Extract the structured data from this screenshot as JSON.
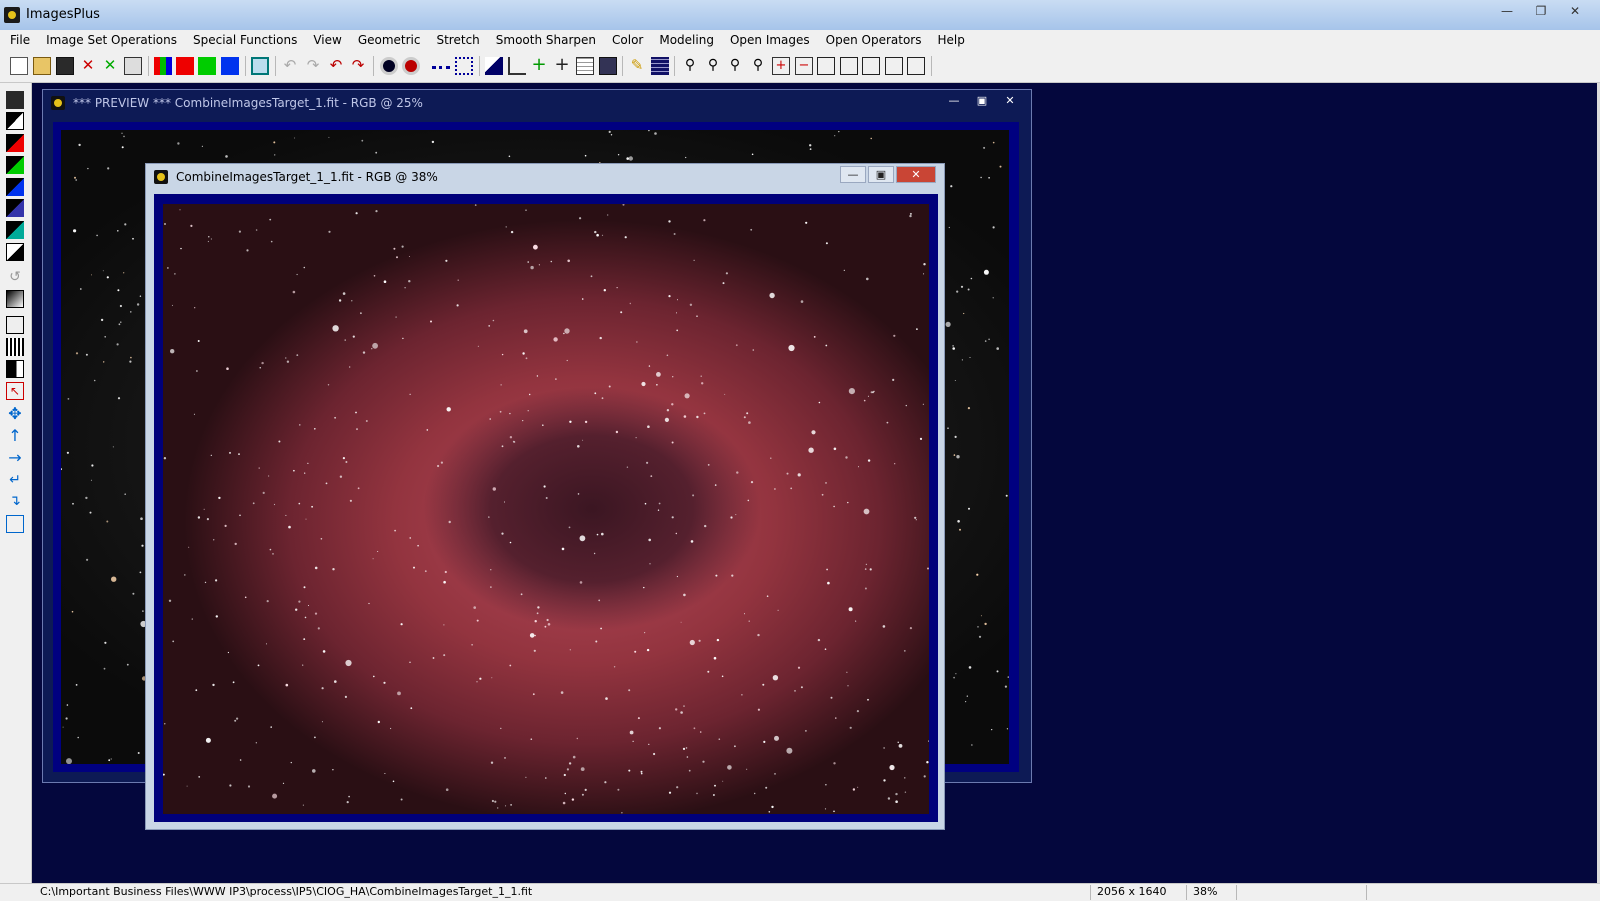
{
  "app": {
    "title": "ImagesPlus",
    "window_controls": [
      "minimize",
      "maximize",
      "close"
    ]
  },
  "menu": [
    "File",
    "Image Set Operations",
    "Special Functions",
    "View",
    "Geometric",
    "Stretch",
    "Smooth Sharpen",
    "Color",
    "Modeling",
    "Open Images",
    "Open Operators",
    "Help"
  ],
  "toolbar": {
    "icons": [
      "new-icon",
      "open-icon",
      "save-icon",
      "close-image-icon",
      "close-all-icon",
      "print-icon",
      "rgb-channels-icon",
      "red-channel-icon",
      "green-channel-icon",
      "blue-channel-icon",
      "grid-icon",
      "undo-disabled-icon",
      "redo-disabled-icon",
      "undo-icon",
      "redo-icon",
      "circle-select-icon",
      "circle-fill-icon",
      "dotted-line-icon",
      "dot-pattern-icon",
      "histogram-icon",
      "curves-icon",
      "crosshair-icon",
      "target-icon",
      "calculator-icon",
      "image-info-icon",
      "pencil-icon",
      "stack-icon",
      "zoom-in-icon",
      "zoom-out-icon",
      "zoom-fit-icon",
      "zoom-actual-icon",
      "add-box-icon",
      "remove-box-icon",
      "frame-1-icon",
      "frame-2-icon",
      "frame-3-icon",
      "frame-4-icon",
      "frame-5-icon"
    ]
  },
  "left_toolbar": {
    "icons": [
      "save-icon",
      "contrast-icon",
      "red-channel-icon",
      "green-channel-icon",
      "blue-channel-icon",
      "luminance-icon",
      "color-balance-icon",
      "invert-icon",
      "brush-icon",
      "gradient-icon",
      "select-icon",
      "levels-icon",
      "black-point-icon",
      "pointer-icon",
      "move-icon",
      "arrow-up-icon",
      "arrow-right-icon",
      "rotate-left-icon",
      "rotate-right-icon",
      "copy-icon"
    ]
  },
  "windows": {
    "preview": {
      "title": "*** PREVIEW *** CombineImagesTarget_1.fit - RGB @ 25%"
    },
    "front": {
      "title": "CombineImagesTarget_1_1.fit - RGB @ 38%"
    }
  },
  "status": {
    "path": "C:\\Important Business Files\\WWW IP3\\process\\IP5\\CIOG_HA\\CombineImagesTarget_1_1.fit",
    "dimensions": "2056 x 1640",
    "zoom": "38%"
  },
  "colors": {
    "workspace": "#04073d",
    "nebula_core": "#b4495a",
    "image_frame": "#00007a"
  }
}
